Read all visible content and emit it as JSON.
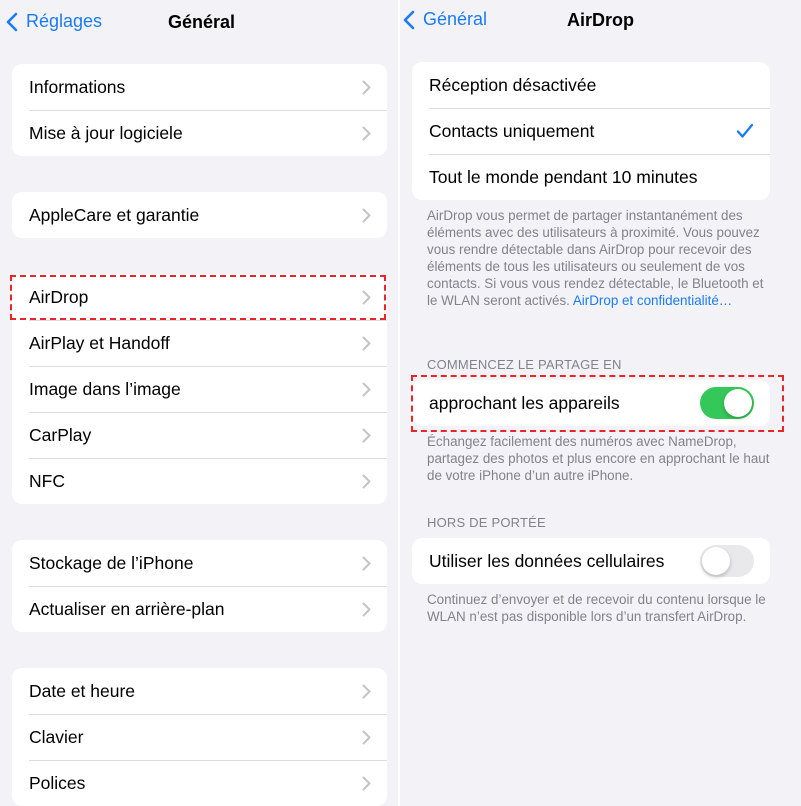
{
  "left": {
    "back_label": "Réglages",
    "title": "Général",
    "groups": [
      [
        "Informations",
        "Mise à jour logiciele"
      ],
      [
        "AppleCare et garantie"
      ],
      [
        "AirDrop",
        "AirPlay et Handoff",
        "Image dans l’image",
        "CarPlay",
        "NFC"
      ],
      [
        "Stockage de l’iPhone",
        "Actualiser en arrière-plan"
      ],
      [
        "Date et heure",
        "Clavier",
        "Polices"
      ]
    ]
  },
  "right": {
    "back_label": "Général",
    "title": "AirDrop",
    "reception": {
      "options": [
        "Réception désactivée",
        "Contacts uniquement",
        "Tout le monde pendant 10 minutes"
      ],
      "selected_index": 1
    },
    "reception_footer": "AirDrop vous permet de partager instantanément des éléments avec des utilisateurs à proximité. Vous pouvez vous rendre détectable dans AirDrop pour recevoir des éléments de tous les utilisateurs ou seulement de vos contacts. Si vous vous rendez détectable, le Bluetooth et le WLAN seront activés.",
    "reception_footer_link": "AirDrop et confidentialité…",
    "start_sharing": {
      "header": "COMMENCEZ LE PARTAGE EN",
      "label": "approchant les appareils",
      "enabled": true,
      "footer": "Échangez facilement des numéros avec NameDrop, partagez des photos et plus encore en approchant le haut de votre iPhone d’un autre iPhone."
    },
    "out_of_range": {
      "header": "HORS DE PORTÉE",
      "label": "Utiliser les données cellulaires",
      "enabled": false,
      "footer": "Continuez d’envoyer et de recevoir du contenu lorsque le WLAN n’est pas disponible lors d’un transfert AirDrop."
    }
  },
  "colors": {
    "accent": "#1a7cf4",
    "toggle_on": "#34c759",
    "highlight": "#e8262a",
    "background": "#f2f2f7"
  },
  "icons": [
    "chevron-left-icon",
    "chevron-right-icon",
    "checkmark-icon"
  ]
}
